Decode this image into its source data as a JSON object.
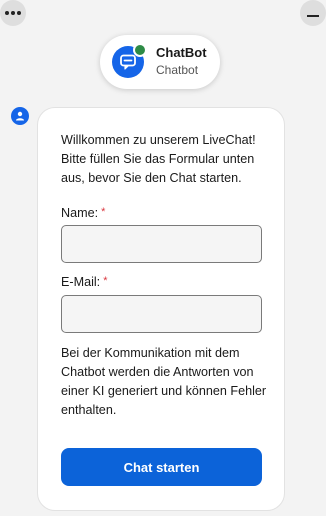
{
  "header": {
    "menu_icon": "more-horizontal-icon",
    "minimize_icon": "minimize-icon",
    "bot_name": "ChatBot",
    "bot_subtitle": "Chatbot",
    "bot_icon": "chat-bubble-icon",
    "status": "online",
    "status_color": "#2e8b46"
  },
  "message": {
    "avatar_icon": "user-icon",
    "intro": "Willkommen zu unserem LiveChat! Bitte füllen Sie das Formular unten aus, bevor Sie den Chat starten.",
    "name_label": "Name:",
    "name_value": "",
    "email_label": "E-Mail:",
    "email_value": "",
    "required_marker": "*",
    "disclaimer": "Bei der Kommunikation mit dem Chatbot werden die Antworten von einer KI generiert und können Fehler enthalten.",
    "start_button": "Chat starten"
  },
  "colors": {
    "accent": "#0c63d9",
    "avatar": "#1565e8",
    "required": "#d9363e",
    "background": "#f3f3f3"
  }
}
